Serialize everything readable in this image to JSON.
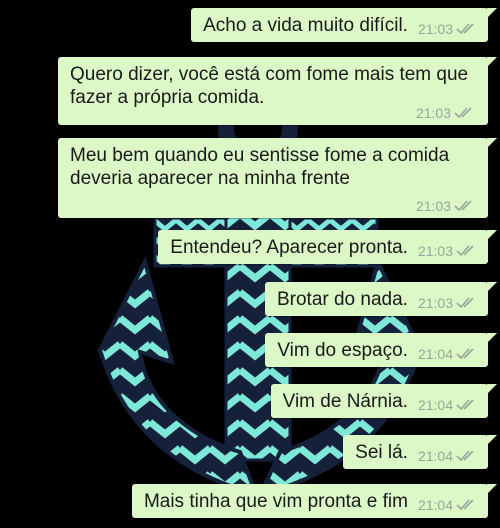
{
  "messages": [
    {
      "text": "Acho a vida muito difícil.",
      "time": "21:03",
      "status": "delivered-double-check"
    },
    {
      "text": "Quero dizer, você está com fome mais tem que fazer a própria comida.",
      "time": "21:03",
      "status": "delivered-double-check"
    },
    {
      "text": "Meu bem quando eu sentisse fome a comida deveria aparecer na minha frente",
      "time": "21:03",
      "status": "delivered-double-check"
    },
    {
      "text": "Entendeu? Aparecer pronta.",
      "time": "21:03",
      "status": "delivered-double-check"
    },
    {
      "text": "Brotar do nada.",
      "time": "21:03",
      "status": "delivered-double-check"
    },
    {
      "text": "Vim do espaço.",
      "time": "21:04",
      "status": "delivered-double-check"
    },
    {
      "text": "Vim de Nárnia.",
      "time": "21:04",
      "status": "delivered-double-check"
    },
    {
      "text": "Sei lá.",
      "time": "21:04",
      "status": "delivered-double-check"
    },
    {
      "text": "Mais tinha que vim pronta e fim",
      "time": "21:04",
      "status": "delivered-double-check"
    }
  ],
  "colors": {
    "bubble": "#dcf8c6",
    "background": "#000000",
    "anchor_navy": "#15213a",
    "anchor_teal": "#7ee8d8",
    "meta_text": "#9aa59a"
  },
  "icons": {
    "wallpaper": "chevron-anchor-wallpaper",
    "message_status": "double-check-icon"
  }
}
